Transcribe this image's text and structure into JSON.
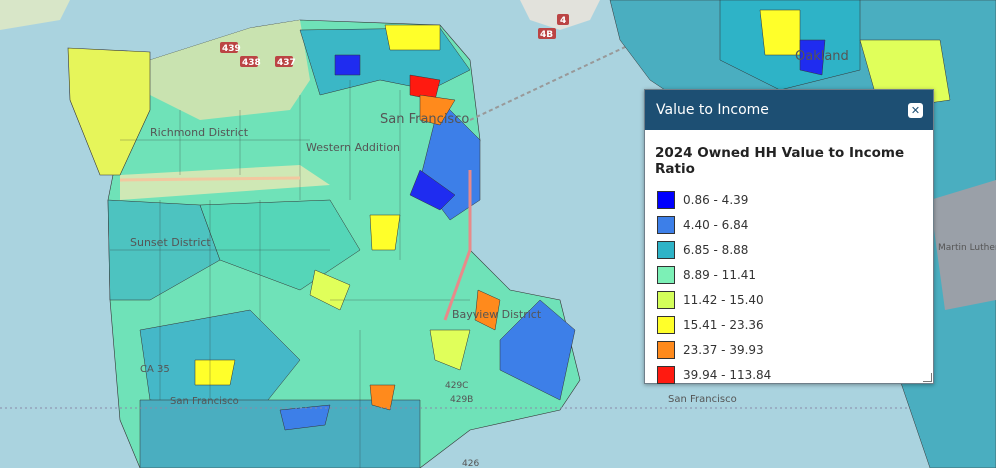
{
  "map": {
    "place_labels": [
      {
        "id": "richmond",
        "text": "Richmond District"
      },
      {
        "id": "western",
        "text": "Western Addition"
      },
      {
        "id": "sunset",
        "text": "Sunset District"
      },
      {
        "id": "sf-city",
        "text": "San Francisco"
      },
      {
        "id": "bayview",
        "text": "Bayview District"
      },
      {
        "id": "oakland",
        "text": "Oakland"
      },
      {
        "id": "sf-south",
        "text": "San Francisco"
      },
      {
        "id": "sf-bay",
        "text": "San Francisco"
      },
      {
        "id": "mlk",
        "text": "Martin Luther King Jr Regional Shoreline"
      }
    ],
    "road_shields": [
      "439",
      "438",
      "437",
      "4",
      "4B",
      "CA 35",
      "429C",
      "429B",
      "426"
    ]
  },
  "legend_panel": {
    "title": "Value to Income",
    "close_icon": "close-icon",
    "subtitle": "2024 Owned HH Value to Income Ratio",
    "items": [
      {
        "label": "0.86 - 4.39",
        "color": "#0000ff"
      },
      {
        "label": "4.40 - 6.84",
        "color": "#3d7fe8"
      },
      {
        "label": "6.85 - 8.88",
        "color": "#2eb3c7"
      },
      {
        "label": "8.89 - 11.41",
        "color": "#7cf0b6"
      },
      {
        "label": "11.42 - 15.40",
        "color": "#d4ff5a"
      },
      {
        "label": "15.41 - 23.36",
        "color": "#ffff2a"
      },
      {
        "label": "23.37 - 39.93",
        "color": "#ff8a1c"
      },
      {
        "label": "39.94 - 113.84",
        "color": "#ff1a10"
      }
    ]
  }
}
